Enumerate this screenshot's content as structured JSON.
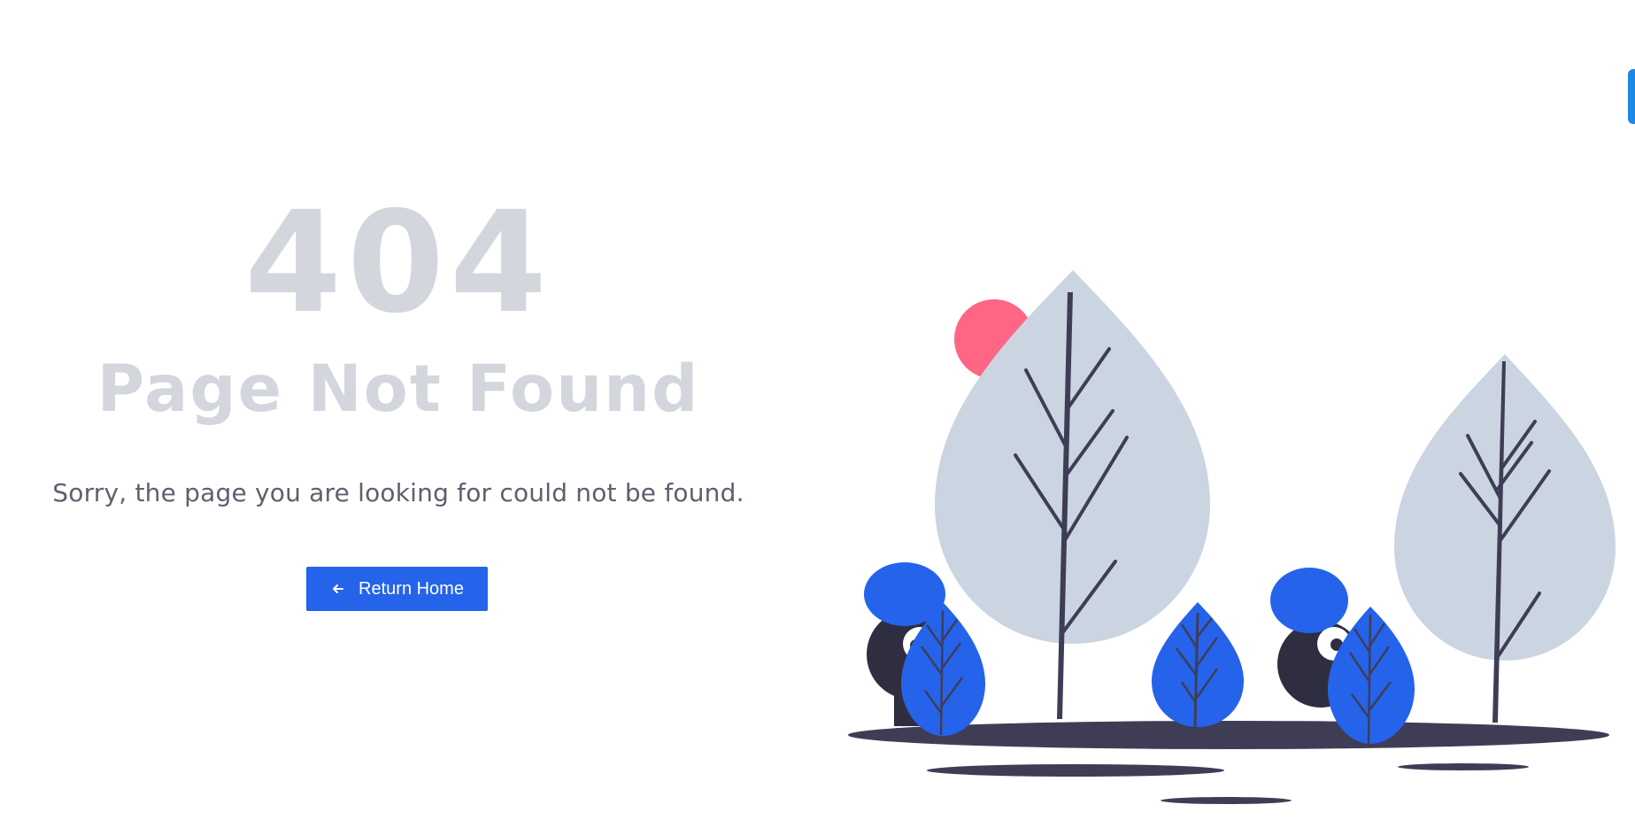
{
  "error": {
    "code": "404",
    "title": "Page Not Found",
    "message": "Sorry, the page you are looking for could not be found."
  },
  "actions": {
    "return_home_label": "Return Home",
    "return_home_icon": "arrow-left-icon"
  },
  "colors": {
    "accent": "#2563eb",
    "heading": "#d4d6de",
    "text": "#5d616d",
    "tree": "#cbd5e1",
    "trunk": "#3f3d56",
    "sun": "#ff6584",
    "edge_tab": "#1e88e5"
  },
  "illustration": {
    "name": "trees-with-hiding-figures-illustration"
  }
}
